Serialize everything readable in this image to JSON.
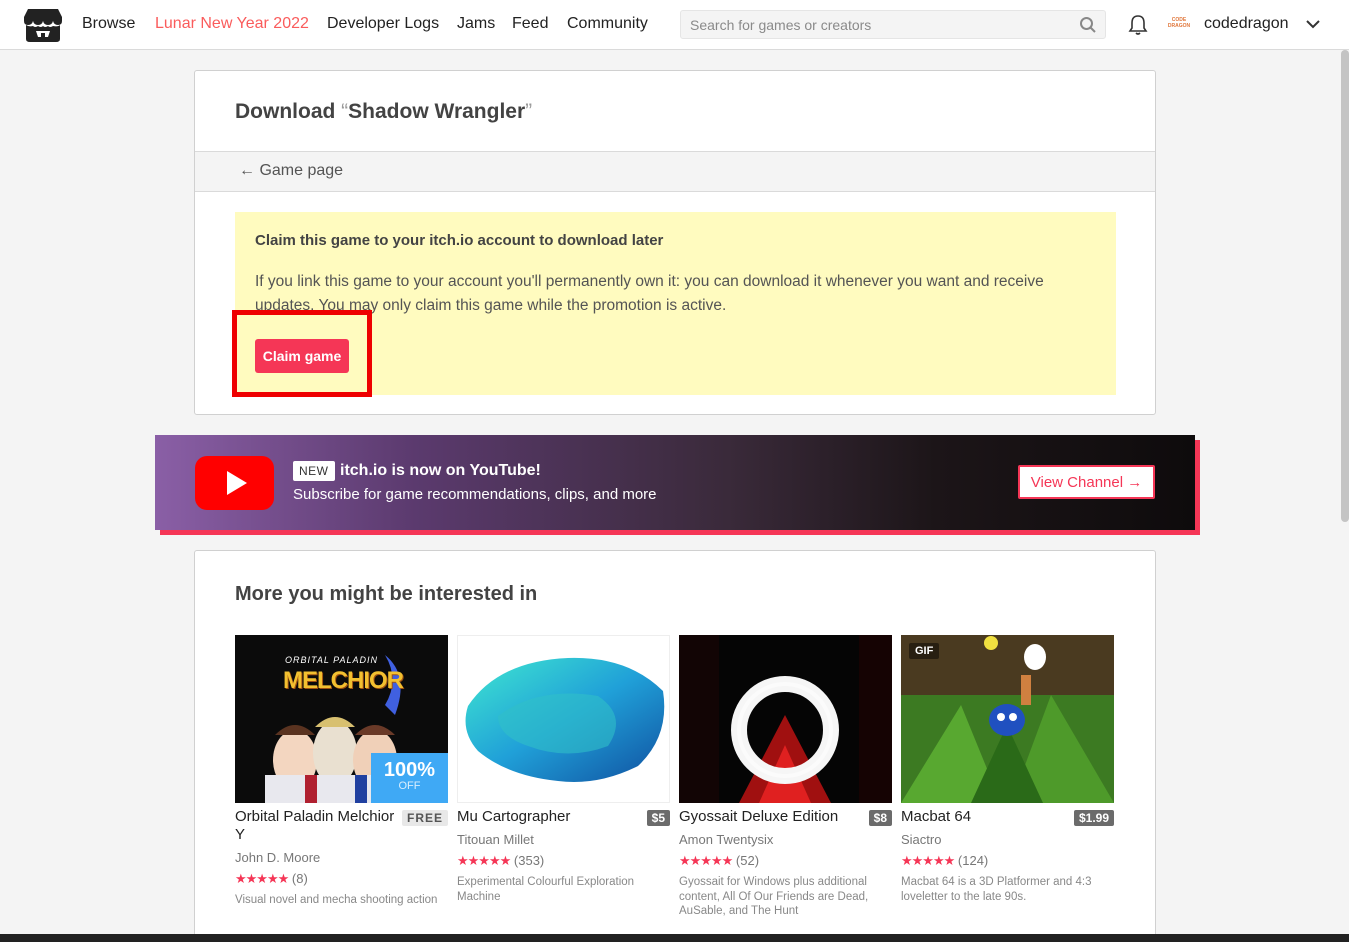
{
  "header": {
    "nav": [
      {
        "label": "Browse"
      },
      {
        "label": "Lunar New Year 2022"
      },
      {
        "label": "Developer Logs"
      },
      {
        "label": "Jams"
      },
      {
        "label": "Feed"
      },
      {
        "label": "Community"
      }
    ],
    "search_placeholder": "Search for games or creators",
    "avatar_text": "CODE DRAGON",
    "username": "codedragon"
  },
  "download": {
    "title_prefix": "Download ",
    "quote_open": "“",
    "game_name": "Shadow Wrangler",
    "quote_close": "”",
    "back_label": "← Game page",
    "claim_heading": "Claim this game to your itch.io account to download later",
    "claim_text": "If you link this game to your account you'll permanently own it: you can download it whenever you want and receive updates. You may only claim this game while the promotion is active.",
    "claim_button": "Claim game"
  },
  "banner": {
    "badge": "NEW",
    "title": "itch.io is now on YouTube!",
    "subtitle": "Subscribe for game recommendations, clips, and more",
    "button": "View Channel →"
  },
  "more": {
    "title": "More you might be interested in",
    "games": [
      {
        "title": "Orbital Paladin Melchior Y",
        "price": "FREE",
        "author": "John D. Moore",
        "stars": "★★★★★",
        "count": "(8)",
        "desc": "Visual novel and mecha shooting action",
        "sale_pct": "100%",
        "sale_off": "OFF",
        "thumb_text_top": "ORBITAL PALADIN",
        "thumb_text_main": "MELCHIOR"
      },
      {
        "title": "Mu Cartographer",
        "price": "$5",
        "author": "Titouan Millet",
        "stars": "★★★★★",
        "count": "(353)",
        "desc": "Experimental Colourful Exploration Machine"
      },
      {
        "title": "Gyossait Deluxe Edition",
        "price": "$8",
        "author": "Amon Twentysix",
        "stars": "★★★★★",
        "count": "(52)",
        "desc": "Gyossait for Windows plus additional content, All Of Our Friends are Dead, AuSable, and The Hunt"
      },
      {
        "title": "Macbat 64",
        "price": "$1.99",
        "author": "Siactro",
        "stars": "★★★★★",
        "count": "(124)",
        "desc": "Macbat 64 is a 3D Platformer and 4:3 loveletter to the late 90s.",
        "gif": "GIF"
      }
    ]
  },
  "colors": {
    "accent": "#fa5c5c",
    "claim": "#f53656",
    "claim_bg": "#fffbbf",
    "highlight": "#ee0000",
    "youtube": "#ff0000",
    "sale": "#3fa9f5"
  }
}
